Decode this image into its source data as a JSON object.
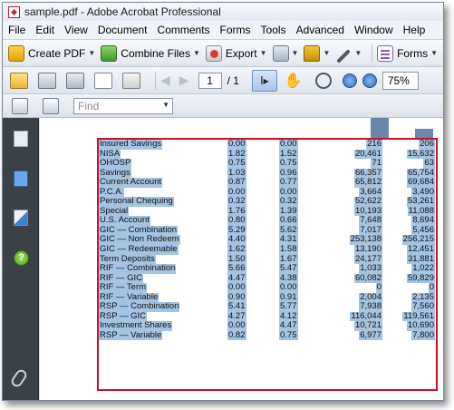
{
  "window": {
    "title": "sample.pdf - Adobe Acrobat Professional"
  },
  "menu": [
    "File",
    "Edit",
    "View",
    "Document",
    "Comments",
    "Forms",
    "Tools",
    "Advanced",
    "Window",
    "Help"
  ],
  "toolbar": {
    "create_pdf": "Create PDF",
    "combine_files": "Combine Files",
    "export": "Export",
    "forms": "Forms"
  },
  "nav": {
    "page_current": "1",
    "page_total": "/ 1",
    "zoom": "75%"
  },
  "find": {
    "placeholder": "Find"
  },
  "sidebar": {
    "help_glyph": "?"
  },
  "colors": {
    "accent_red": "#c8102e",
    "selection": "#a4c4e3"
  },
  "table": {
    "rows": [
      {
        "label": "Insured Savings",
        "v1": "0.00",
        "v2": "0.00",
        "v3": "216",
        "v4": "206"
      },
      {
        "label": "NISA",
        "v1": "1.82",
        "v2": "1.52",
        "v3": "20,461",
        "v4": "15,632"
      },
      {
        "label": "OHOSP",
        "v1": "0.75",
        "v2": "0.75",
        "v3": "71",
        "v4": "63"
      },
      {
        "label": "Savings",
        "v1": "1.03",
        "v2": "0.96",
        "v3": "66,357",
        "v4": "65,754"
      },
      {
        "label": "Current Account",
        "v1": "0.87",
        "v2": "0.77",
        "v3": "65,812",
        "v4": "69,684"
      },
      {
        "label": "P.C.A.",
        "v1": "0.00",
        "v2": "0.00",
        "v3": "3,664",
        "v4": "3,490"
      },
      {
        "label": "Personal Chequing",
        "v1": "0.32",
        "v2": "0.32",
        "v3": "52,622",
        "v4": "53,261"
      },
      {
        "label": "Special",
        "v1": "1.76",
        "v2": "1.39",
        "v3": "10,193",
        "v4": "11,088"
      },
      {
        "label": "U.S. Account",
        "v1": "0.80",
        "v2": "0.66",
        "v3": "7,648",
        "v4": "8,694"
      },
      {
        "label": "GIC — Combination",
        "v1": "5.29",
        "v2": "5.62",
        "v3": "7,017",
        "v4": "5,456"
      },
      {
        "label": "GIC — Non Redeem",
        "v1": "4.40",
        "v2": "4.31",
        "v3": "253,138",
        "v4": "256,215"
      },
      {
        "label": "GIC — Redeemable",
        "v1": "1.62",
        "v2": "1.58",
        "v3": "13,190",
        "v4": "12,451"
      },
      {
        "label": "Term Deposits",
        "v1": "1.50",
        "v2": "1.67",
        "v3": "24,177",
        "v4": "31,881"
      },
      {
        "label": "RIF — Combination",
        "v1": "5.66",
        "v2": "5.47",
        "v3": "1,033",
        "v4": "1,022"
      },
      {
        "label": "RIF — GIC",
        "v1": "4.47",
        "v2": "4.38",
        "v3": "60,082",
        "v4": "59,829"
      },
      {
        "label": "RIF — Term",
        "v1": "0.00",
        "v2": "0.00",
        "v3": "0",
        "v4": "0"
      },
      {
        "label": "RIF — Variable",
        "v1": "0.90",
        "v2": "0.91",
        "v3": "2,004",
        "v4": "2,135"
      },
      {
        "label": "RSP — Combination",
        "v1": "5.41",
        "v2": "5.77",
        "v3": "7,938",
        "v4": "7,560"
      },
      {
        "label": "RSP — GIC",
        "v1": "4.27",
        "v2": "4.12",
        "v3": "116,044",
        "v4": "119,561"
      },
      {
        "label": "Investment Shares",
        "v1": "0.00",
        "v2": "4.47",
        "v3": "10,721",
        "v4": "10,690"
      },
      {
        "label": "RSP — Variable",
        "v1": "0.82",
        "v2": "0.75",
        "v3": "6,977",
        "v4": "7,800"
      }
    ]
  }
}
